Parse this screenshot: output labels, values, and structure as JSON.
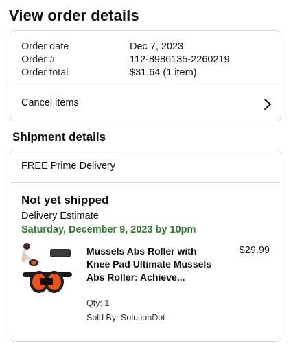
{
  "page": {
    "title": "View order details"
  },
  "order": {
    "date_label": "Order date",
    "date_value": "Dec 7, 2023",
    "number_label": "Order #",
    "number_value": "112-8986135-2260219",
    "total_label": "Order total",
    "total_value": "$31.64 (1 item)",
    "cancel_label": "Cancel items"
  },
  "shipment": {
    "section_title": "Shipment details",
    "delivery_type": "FREE Prime Delivery",
    "status": "Not yet shipped",
    "estimate_label": "Delivery Estimate",
    "estimate_date": "Saturday, December 9, 2023 by 10pm",
    "item": {
      "title": "Mussels Abs Roller with Knee Pad Ultimate Mussels Abs Roller: Achieve...",
      "price": "$29.99",
      "qty": "Qty: 1",
      "sold_by": "Sold By: SolutionDot",
      "image_icon": "abs-roller-product-photo"
    }
  },
  "colors": {
    "estimate_green": "#2f7a31",
    "border": "#d5d9d9",
    "text": "#0f1111"
  },
  "icons": {
    "cancel_chevron": "chevron-right-icon"
  }
}
